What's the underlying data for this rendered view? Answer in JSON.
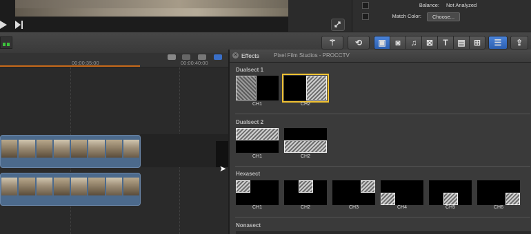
{
  "inspector": {
    "rows": [
      {
        "label": "Balance:",
        "value": "Not Analyzed"
      },
      {
        "label": "Match Color:",
        "value": ""
      }
    ],
    "choose_label": "Choose..."
  },
  "timeline": {
    "ticks": [
      "00:00:35:00",
      "00:00:40:00"
    ]
  },
  "effects": {
    "title": "Effects",
    "source": "Pixel Film Studios - PROCCTV",
    "sections": [
      {
        "name": "Dualsect 1",
        "items": [
          "CH1",
          "CH2"
        ]
      },
      {
        "name": "Dualsect 2",
        "items": [
          "CH1",
          "CH2"
        ]
      },
      {
        "name": "Hexasect",
        "items": [
          "CH1",
          "CH2",
          "CH3",
          "CH4",
          "CH5",
          "CH6"
        ]
      },
      {
        "name": "Nonasect",
        "items": []
      }
    ]
  },
  "colors": {
    "accent": "#2c5fb0",
    "selection": "#f1c232",
    "playhead": "#c86a1a",
    "clip": "#4c6a8c"
  },
  "icons": [
    "play-icon",
    "skip-forward-icon",
    "fullscreen-icon",
    "magic-wand-icon",
    "retime-icon",
    "browser-icon",
    "photo-icon",
    "music-icon",
    "titles-generator-icon",
    "text-icon",
    "themes-icon",
    "transitions-icon",
    "effects-icon",
    "share-icon",
    "close-icon",
    "cursor-icon"
  ]
}
